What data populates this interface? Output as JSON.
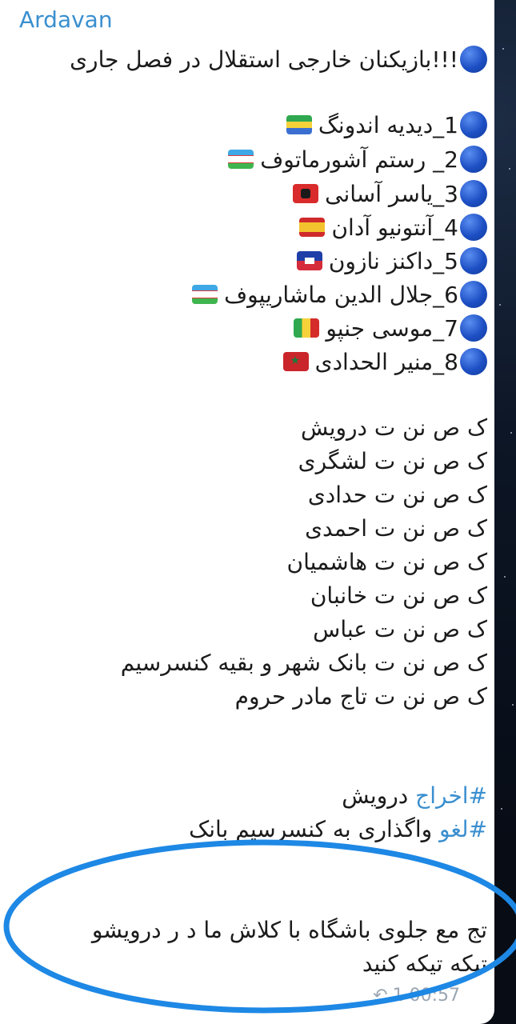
{
  "chat": {
    "sender": "Ardavan",
    "headline": "!!!بازیکنان خارجی استقلال در فصل جاری",
    "players": [
      {
        "number": "1",
        "name": "_دیدیه اندونگ",
        "flag": "gabon-flag-icon"
      },
      {
        "number": "2",
        "name": "_ رستم آشورماتوف",
        "flag": "uzbekistan-flag-icon"
      },
      {
        "number": "3",
        "name": "_یاسر آسانی",
        "flag": "albania-flag-icon"
      },
      {
        "number": "4",
        "name": "_آنتونیو آدان",
        "flag": "spain-flag-icon"
      },
      {
        "number": "5",
        "name": "_داکنز نازون",
        "flag": "haiti-flag-icon"
      },
      {
        "number": "6",
        "name": "_جلال الدین ماشاریپوف",
        "flag": "uzbekistan-flag-icon"
      },
      {
        "number": "7",
        "name": "_موسی جنپو",
        "flag": "mali-flag-icon"
      },
      {
        "number": "8",
        "name": "_منیر الحدادی",
        "flag": "morocco-flag-icon"
      }
    ],
    "lines": [
      "ک ص نن ت درویش",
      "ک ص نن ت لشگری",
      "ک ص نن ت حدادی",
      "ک ص نن ت احمدی",
      "ک ص نن ت هاشمیان",
      "ک ص نن ت خانبان",
      "ک ص نن ت عباس",
      "ک ص نن ت بانک شهر و بقیه کنسرسیم",
      "ک ص نن ت تاج مادر حروم"
    ],
    "hashtags": [
      {
        "tag": "#اخراج",
        "text": " درویش"
      },
      {
        "tag": "#لغو",
        "text": " واگذاری به کنسرسیم بانک"
      }
    ],
    "closing": [
      "تج مع جلوی باشگاه با کلاش ما د ر درویشو",
      "تیکه تیکه کنید"
    ],
    "time": "00:57",
    "forward_count": "1"
  },
  "colors": {
    "link": "#3a8fcf",
    "bullet": "#1d4fc4",
    "annotation": "#1e88e5"
  }
}
